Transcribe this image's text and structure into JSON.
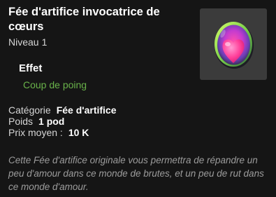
{
  "item": {
    "name": "Fée d'artifice invocatrice de cœurs",
    "level_label": "Niveau",
    "level_value": "1",
    "icon": "heart-egg-icon"
  },
  "effects": {
    "title": "Effet",
    "items": [
      "Coup de poing"
    ],
    "color": "#69b24a"
  },
  "stats": {
    "category_label": "Catégorie",
    "category_value": "Fée d'artifice",
    "weight_label": "Poids",
    "weight_value": "1 pod",
    "price_label": "Prix moyen :",
    "price_value": "10 K"
  },
  "description": "Cette Fée d'artifice originale vous permettra de répandre un peu d'amour dans ce monde de brutes, et un peu de rut dans ce monde d'amour."
}
